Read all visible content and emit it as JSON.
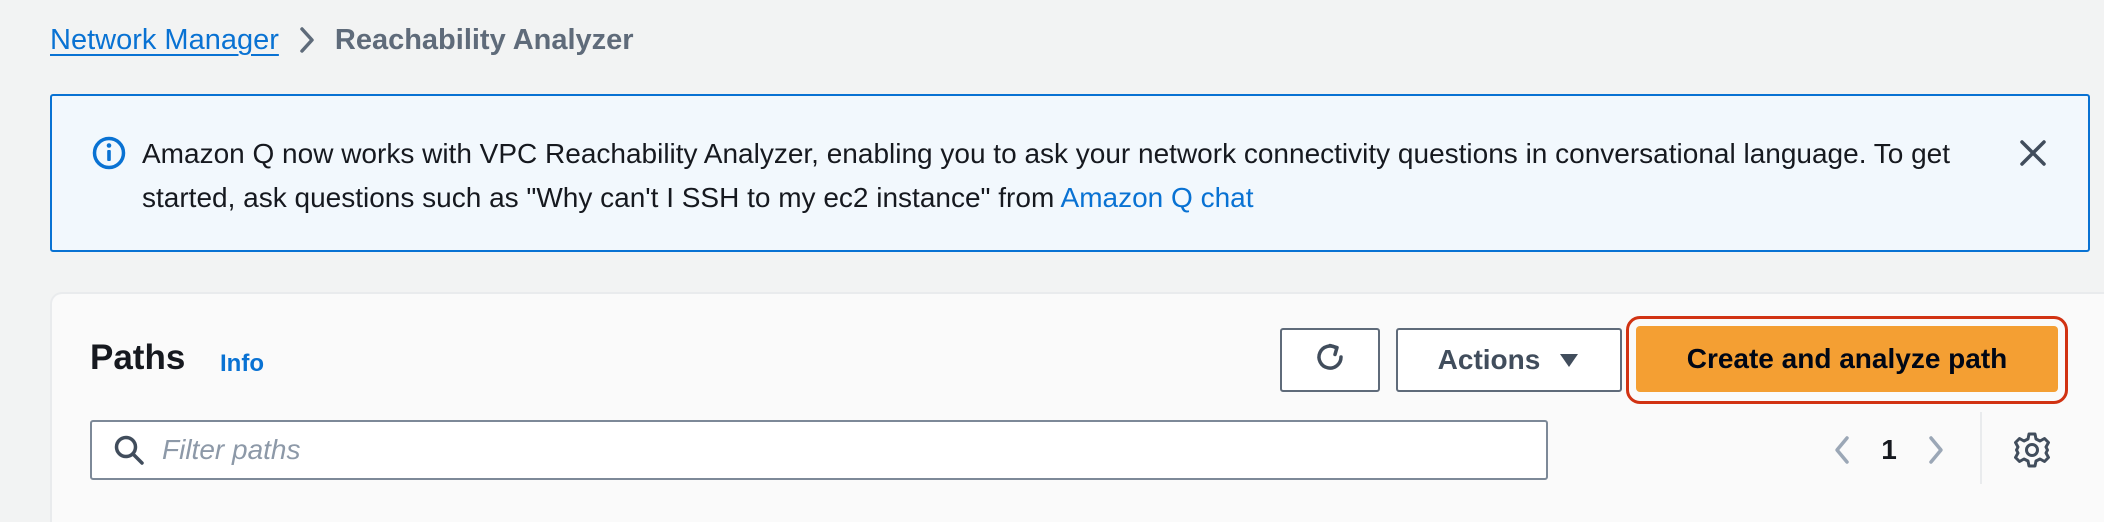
{
  "breadcrumb": {
    "parent": "Network Manager",
    "current": "Reachability Analyzer"
  },
  "flash": {
    "type": "info",
    "text": "Amazon Q now works with VPC Reachability Analyzer, enabling you to ask your network connectivity questions in conversational language. To get started, ask questions such as \"Why can't I SSH to my ec2 instance\" from ",
    "link_label": "Amazon Q chat",
    "icon": "info-circle-icon",
    "close_icon": "close-icon"
  },
  "paths_panel": {
    "title": "Paths",
    "info_label": "Info",
    "refresh_icon": "refresh-icon",
    "actions_label": "Actions",
    "create_label": "Create and analyze path",
    "search_placeholder": "Filter paths",
    "search_value": "",
    "pagination": {
      "current_page": "1"
    }
  },
  "colors": {
    "link": "#0972d3",
    "primary_button": "#f49f33",
    "highlight_outline": "#d13212",
    "flash_background": "#f2f8fd"
  }
}
